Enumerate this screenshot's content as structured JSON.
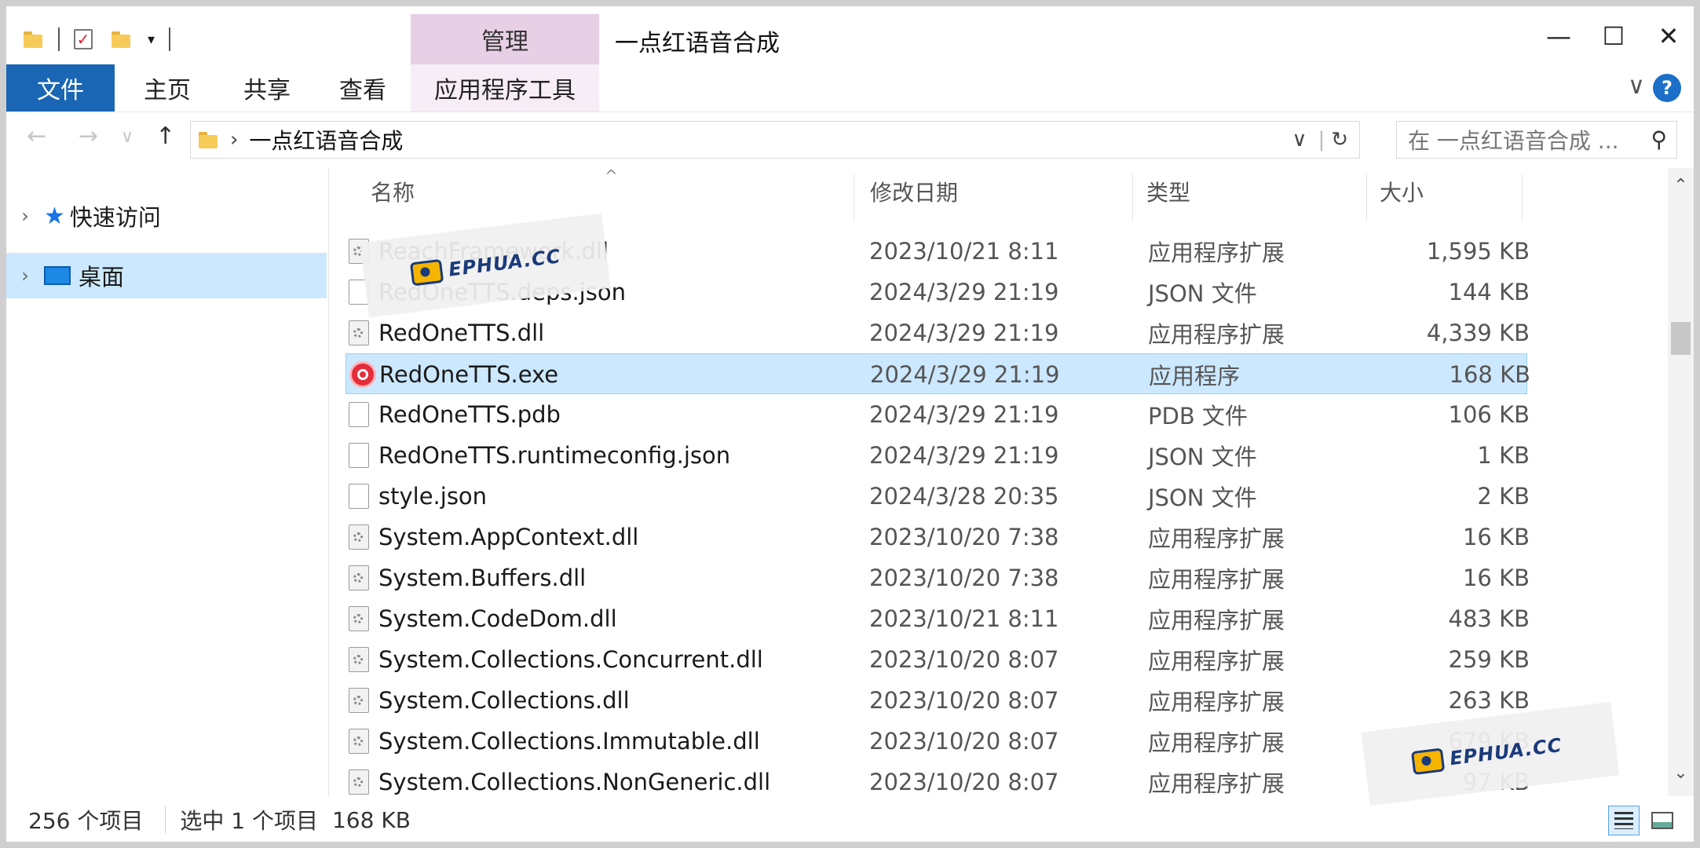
{
  "window": {
    "title": "一点红语音合成",
    "manage_tab": "管理",
    "minimize": "—",
    "maximize": "☐",
    "close": "✕"
  },
  "ribbon": {
    "tabs": [
      "文件",
      "主页",
      "共享",
      "查看",
      "应用程序工具"
    ],
    "collapse": "∨",
    "help": "?"
  },
  "nav": {
    "back": "←",
    "forward": "→",
    "recent": "∨",
    "up": "↑",
    "path_chevron": "›",
    "path": "一点红语音合成",
    "dropdown": "∨",
    "refresh": "↻",
    "search_placeholder": "在 一点红语音合成 ...",
    "search_icon": "⚲"
  },
  "sidebar": {
    "items": [
      {
        "label": "快速访问",
        "icon": "star-icon",
        "selected": false
      },
      {
        "label": "桌面",
        "icon": "desktop-icon",
        "selected": true
      }
    ]
  },
  "columns": {
    "name": "名称",
    "date": "修改日期",
    "type": "类型",
    "size": "大小"
  },
  "files": [
    {
      "name": "ReachFramework.dll",
      "date": "2023/10/21 8:11",
      "type": "应用程序扩展",
      "size": "1,595 KB",
      "icon": "dll"
    },
    {
      "name": "RedOneTTS.deps.json",
      "date": "2024/3/29 21:19",
      "type": "JSON 文件",
      "size": "144 KB",
      "icon": "doc"
    },
    {
      "name": "RedOneTTS.dll",
      "date": "2024/3/29 21:19",
      "type": "应用程序扩展",
      "size": "4,339 KB",
      "icon": "dll"
    },
    {
      "name": "RedOneTTS.exe",
      "date": "2024/3/29 21:19",
      "type": "应用程序",
      "size": "168 KB",
      "icon": "exe",
      "selected": true
    },
    {
      "name": "RedOneTTS.pdb",
      "date": "2024/3/29 21:19",
      "type": "PDB 文件",
      "size": "106 KB",
      "icon": "doc"
    },
    {
      "name": "RedOneTTS.runtimeconfig.json",
      "date": "2024/3/29 21:19",
      "type": "JSON 文件",
      "size": "1 KB",
      "icon": "doc"
    },
    {
      "name": "style.json",
      "date": "2024/3/28 20:35",
      "type": "JSON 文件",
      "size": "2 KB",
      "icon": "doc"
    },
    {
      "name": "System.AppContext.dll",
      "date": "2023/10/20 7:38",
      "type": "应用程序扩展",
      "size": "16 KB",
      "icon": "dll"
    },
    {
      "name": "System.Buffers.dll",
      "date": "2023/10/20 7:38",
      "type": "应用程序扩展",
      "size": "16 KB",
      "icon": "dll"
    },
    {
      "name": "System.CodeDom.dll",
      "date": "2023/10/21 8:11",
      "type": "应用程序扩展",
      "size": "483 KB",
      "icon": "dll"
    },
    {
      "name": "System.Collections.Concurrent.dll",
      "date": "2023/10/20 8:07",
      "type": "应用程序扩展",
      "size": "259 KB",
      "icon": "dll"
    },
    {
      "name": "System.Collections.dll",
      "date": "2023/10/20 8:07",
      "type": "应用程序扩展",
      "size": "263 KB",
      "icon": "dll"
    },
    {
      "name": "System.Collections.Immutable.dll",
      "date": "2023/10/20 8:07",
      "type": "应用程序扩展",
      "size": "679 KB",
      "icon": "dll"
    },
    {
      "name": "System.Collections.NonGeneric.dll",
      "date": "2023/10/20 8:07",
      "type": "应用程序扩展",
      "size": "97 KB",
      "icon": "dll"
    }
  ],
  "status": {
    "count": "256 个项目",
    "selected": "选中 1 个项目",
    "selected_size": "168 KB"
  },
  "scroll": {
    "up": "⌃",
    "down": "⌄"
  },
  "watermark": {
    "text": "EPHUA.CC"
  },
  "colors": {
    "accent": "#1a66b5",
    "selection": "#cce8ff",
    "manage": "#e7cfe5"
  }
}
